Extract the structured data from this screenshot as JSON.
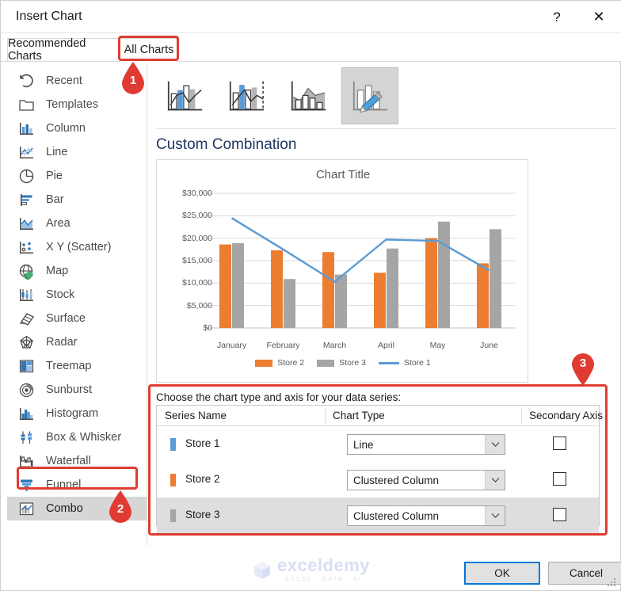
{
  "window": {
    "title": "Insert Chart",
    "help_label": "?",
    "close_label": "✕"
  },
  "tabs": [
    {
      "id": "recommended",
      "label": "Recommended Charts",
      "selected": false
    },
    {
      "id": "all",
      "label": "All Charts",
      "selected": true
    }
  ],
  "sidebar": {
    "items": [
      {
        "label": "Recent",
        "icon": "recent-icon",
        "selected": false
      },
      {
        "label": "Templates",
        "icon": "templates-icon",
        "selected": false
      },
      {
        "label": "Column",
        "icon": "column-icon",
        "selected": false
      },
      {
        "label": "Line",
        "icon": "line-icon",
        "selected": false
      },
      {
        "label": "Pie",
        "icon": "pie-icon",
        "selected": false
      },
      {
        "label": "Bar",
        "icon": "bar-icon",
        "selected": false
      },
      {
        "label": "Area",
        "icon": "area-icon",
        "selected": false
      },
      {
        "label": "X Y (Scatter)",
        "icon": "scatter-icon",
        "selected": false
      },
      {
        "label": "Map",
        "icon": "map-icon",
        "selected": false
      },
      {
        "label": "Stock",
        "icon": "stock-icon",
        "selected": false
      },
      {
        "label": "Surface",
        "icon": "surface-icon",
        "selected": false
      },
      {
        "label": "Radar",
        "icon": "radar-icon",
        "selected": false
      },
      {
        "label": "Treemap",
        "icon": "treemap-icon",
        "selected": false
      },
      {
        "label": "Sunburst",
        "icon": "sunburst-icon",
        "selected": false
      },
      {
        "label": "Histogram",
        "icon": "histogram-icon",
        "selected": false
      },
      {
        "label": "Box & Whisker",
        "icon": "box-whisker-icon",
        "selected": false
      },
      {
        "label": "Waterfall",
        "icon": "waterfall-icon",
        "selected": false
      },
      {
        "label": "Funnel",
        "icon": "funnel-icon",
        "selected": false
      },
      {
        "label": "Combo",
        "icon": "combo-icon",
        "selected": true
      }
    ]
  },
  "gallery": {
    "thumbnails": [
      {
        "name": "clustered-column-line-thumb",
        "selected": false
      },
      {
        "name": "clustered-column-line-secondary-thumb",
        "selected": false
      },
      {
        "name": "stacked-area-clustered-column-thumb",
        "selected": false
      },
      {
        "name": "custom-combination-thumb",
        "selected": true
      }
    ]
  },
  "preview": {
    "heading": "Custom Combination"
  },
  "series_panel": {
    "prompt": "Choose the chart type and axis for your data series:",
    "columns": {
      "series_name": "Series Name",
      "chart_type": "Chart Type",
      "secondary_axis": "Secondary Axis"
    },
    "rows": [
      {
        "name": "Store 1",
        "chart_type": "Line",
        "secondary_axis": false,
        "color": "#5B9BD5"
      },
      {
        "name": "Store 2",
        "chart_type": "Clustered Column",
        "secondary_axis": false,
        "color": "#ED7D31"
      },
      {
        "name": "Store 3",
        "chart_type": "Clustered Column",
        "secondary_axis": false,
        "color": "#A5A5A5"
      }
    ]
  },
  "footer": {
    "ok_label": "OK",
    "cancel_label": "Cancel"
  },
  "watermark": {
    "name": "exceldemy",
    "tagline": "EXCEL  ·  DATA  ·  BI"
  },
  "annotations": [
    {
      "number": "1",
      "target": "All Charts tab"
    },
    {
      "number": "2",
      "target": "Combo sidebar item"
    },
    {
      "number": "3",
      "target": "Series type and axis panel"
    }
  ],
  "colors": {
    "series_1": "#5B9BD5",
    "series_2": "#ED7D31",
    "series_3": "#A5A5A5",
    "annotation_red": "#E03B32",
    "accent_blue": "#0078D7",
    "heading_navy": "#1F3864"
  },
  "chart_data": {
    "type": "bar",
    "title": "Chart Title",
    "xlabel": "",
    "ylabel": "",
    "categories": [
      "January",
      "February",
      "March",
      "April",
      "May",
      "June"
    ],
    "series": [
      {
        "name": "Store 2",
        "type": "column",
        "color": "#ED7D31",
        "values": [
          18600,
          17300,
          16900,
          12300,
          20000,
          14400
        ]
      },
      {
        "name": "Store 3",
        "type": "column",
        "color": "#A5A5A5",
        "values": [
          18900,
          10900,
          11900,
          17700,
          23700,
          22000
        ]
      },
      {
        "name": "Store 1",
        "type": "line",
        "color": "#5B9BD5",
        "values": [
          24500,
          17500,
          10300,
          19700,
          19400,
          12800
        ]
      }
    ],
    "ylim": [
      0,
      30000
    ],
    "yticks": [
      0,
      5000,
      10000,
      15000,
      20000,
      25000,
      30000
    ],
    "ytick_labels": [
      "$0",
      "$5,000",
      "$10,000",
      "$15,000",
      "$20,000",
      "$25,000",
      "$30,000"
    ],
    "grid": true,
    "legend_position": "bottom",
    "legend_order": [
      "Store 2",
      "Store 3",
      "Store 1"
    ]
  }
}
